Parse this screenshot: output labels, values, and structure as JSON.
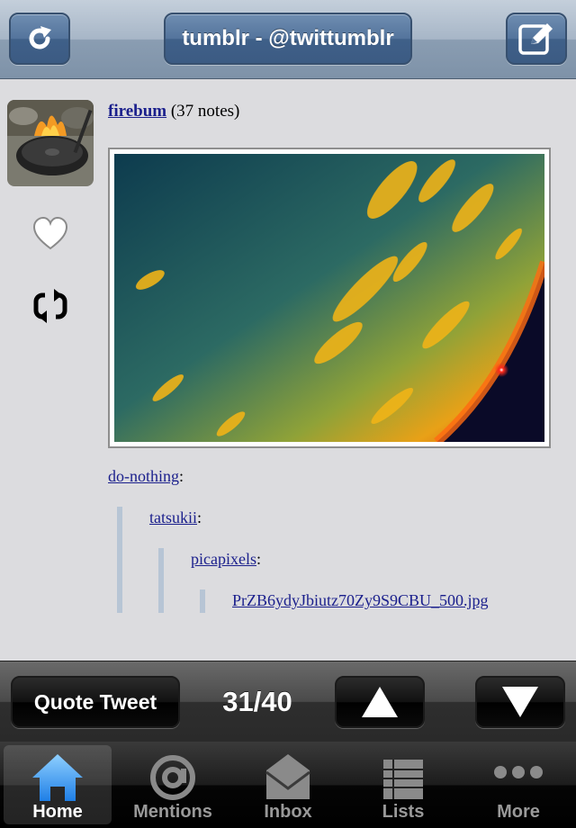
{
  "navbar": {
    "title": "tumblr - @twittumblr",
    "left_icon": "refresh-icon",
    "right_icon": "compose-icon"
  },
  "post": {
    "author": "firebum",
    "notes": "(37 notes)",
    "like_icon": "heart-icon",
    "reblog_icon": "reblog-icon",
    "chain": [
      {
        "name": "do-nothing",
        "colon": ":"
      },
      {
        "name": "tatsukii",
        "colon": ":"
      },
      {
        "name": "picapixels",
        "colon": ":"
      },
      {
        "name": "PrZB6ydyJbiutz70Zy9S9CBU_500.jpg",
        "colon": ""
      }
    ]
  },
  "toolbar": {
    "quote_label": "Quote Tweet",
    "counter": "31/40",
    "up_icon": "up-arrow-icon",
    "down_icon": "down-arrow-icon"
  },
  "tabs": [
    {
      "label": "Home",
      "icon": "home-icon",
      "active": true
    },
    {
      "label": "Mentions",
      "icon": "at-icon",
      "active": false
    },
    {
      "label": "Inbox",
      "icon": "inbox-icon",
      "active": false
    },
    {
      "label": "Lists",
      "icon": "list-icon",
      "active": false
    },
    {
      "label": "More",
      "icon": "more-icon",
      "active": false
    }
  ],
  "colors": {
    "navbar": "#8a9db2",
    "link": "#1a1f8c",
    "quote_bar": "#b7c5d5",
    "tab_active": "#4aa3ff"
  }
}
